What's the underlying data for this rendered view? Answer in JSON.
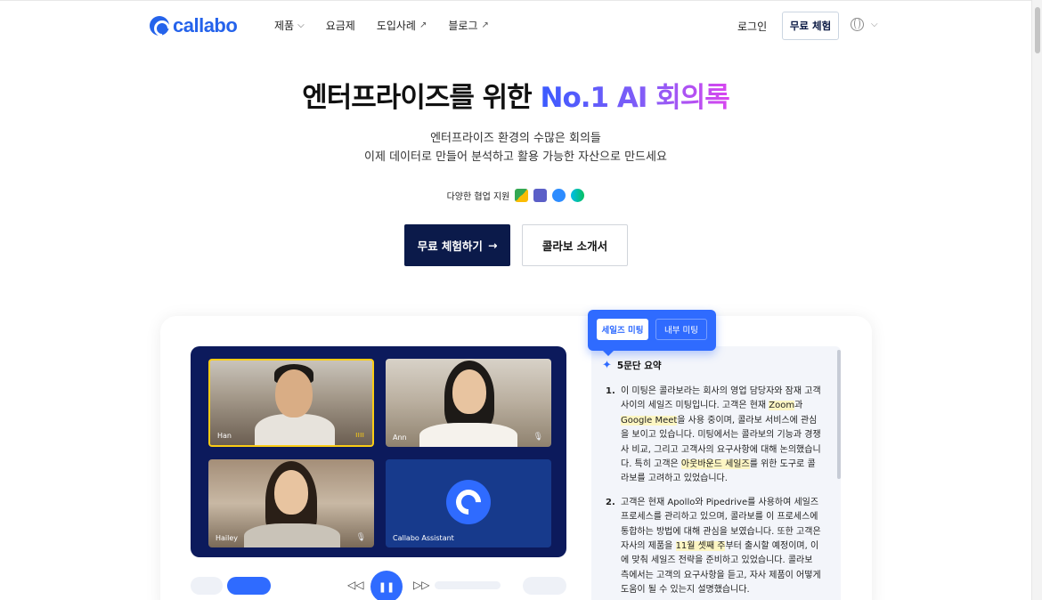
{
  "brand": {
    "name": "callabo",
    "color": "#2563eb"
  },
  "nav": {
    "items": [
      {
        "label": "제품",
        "icon": "chevron-down-icon",
        "glyph": "⌵"
      },
      {
        "label": "요금제"
      },
      {
        "label": "도입사례",
        "icon": "external-link-icon",
        "glyph": "↗"
      },
      {
        "label": "블로그",
        "icon": "external-link-icon",
        "glyph": "↗"
      }
    ],
    "login": "로그인",
    "trial": "무료 체험",
    "lang_icon": "globe-icon"
  },
  "hero": {
    "title_plain": "엔터프라이즈를 위한 ",
    "title_accent": "No.1 AI 회의록",
    "subtitle_line1": "엔터프라이즈 환경의 수많은 회의들",
    "subtitle_line2": "이제 데이터로 만들어 분석하고 활용 가능한 자산으로 만드세요",
    "collab_label": "다양한 협업 지원",
    "collab_apps": [
      "google-meet-icon",
      "ms-teams-icon",
      "zoom-icon",
      "webex-icon"
    ],
    "cta_primary": "무료 체험하기",
    "cta_primary_arrow": "→",
    "cta_secondary": "콜라보 소개서"
  },
  "demo": {
    "participants": [
      {
        "name": "Han"
      },
      {
        "name": "Ann"
      },
      {
        "name": "Hailey"
      },
      {
        "name": "Callabo Assistant"
      }
    ],
    "tabs": {
      "active": "세일즈 미팅",
      "inactive": "내부 미팅"
    },
    "summary_title": "5문단 요약",
    "summary": [
      {
        "num": "1.",
        "parts": [
          {
            "t": "이 미팅은 콜라보라는 회사의 영업 담당자와 잠재 고객 사이의 세일즈 미팅입니다. 고객은 현재 "
          },
          {
            "t": "Zoom",
            "hl": true
          },
          {
            "t": "과 "
          },
          {
            "t": "Google Meet",
            "hl": true
          },
          {
            "t": "을 사용 중이며, 콜라보 서비스에 관심을 보이고 있습니다. 미팅에서는 콜라보의 기능과 경쟁사 비교, 그리고 고객사의 요구사항에 대해 논의했습니다. 특히 고객은 "
          },
          {
            "t": "아웃바운드 세일즈",
            "hl": true
          },
          {
            "t": "를 위한 도구로 콜라보를 고려하고 있었습니다."
          }
        ]
      },
      {
        "num": "2.",
        "parts": [
          {
            "t": "고객은 현재 Apollo와 Pipedrive를 사용하여 세일즈 프로세스를 관리하고 있으며, 콜라보를 이 프로세스에 통합하는 방법에 대해 관심을 보였습니다. 또한 고객은 자사의 제품을 "
          },
          {
            "t": "11월 셋째 주",
            "hl": true
          },
          {
            "t": "부터 출시할 예정이며, 이에 맞춰 세일즈 전략을 준비하고 있었습니다. 콜라보 측에서는 고객의 요구사항을 듣고, 자사 제품이 어떻게 도움이 될 수 있는지 설명했습니다."
          }
        ]
      }
    ]
  }
}
